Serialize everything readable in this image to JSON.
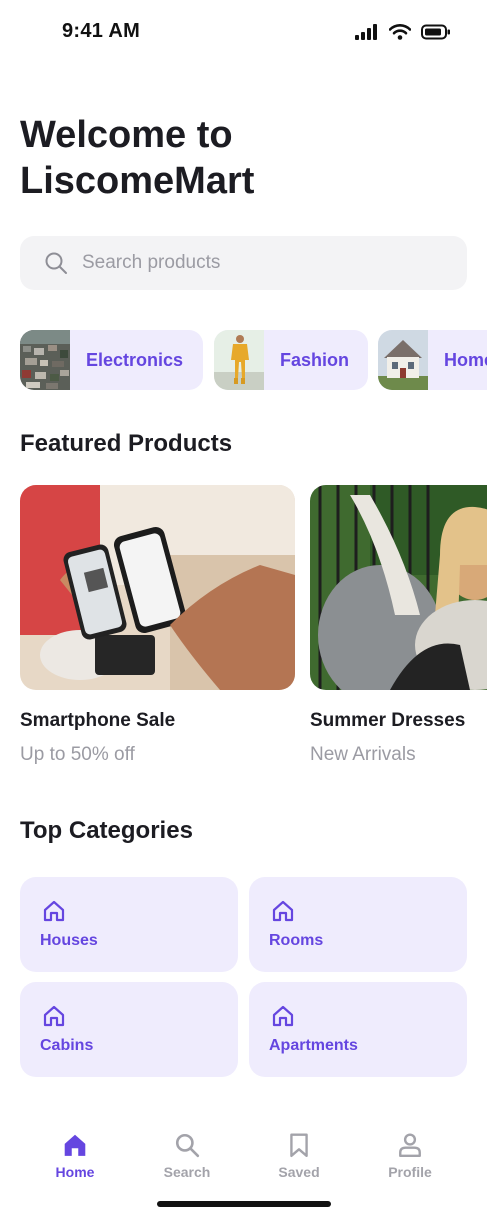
{
  "status_bar": {
    "time": "9:41 AM",
    "icons": [
      "signal-icon",
      "wifi-icon",
      "battery-icon"
    ]
  },
  "header": {
    "title_line1": "Welcome to",
    "title_line2": "LiscomeMart"
  },
  "search": {
    "placeholder": "Search products",
    "value": "",
    "icon": "search-icon"
  },
  "chips": [
    {
      "label": "Electronics",
      "thumb": "aerial-city-photo"
    },
    {
      "label": "Fashion",
      "thumb": "fashion-model-photo"
    },
    {
      "label": "Home",
      "thumb": "house-photo"
    }
  ],
  "featured": {
    "title": "Featured Products",
    "items": [
      {
        "name": "Smartphone Sale",
        "subtitle": "Up to 50% off",
        "image": "phone-payment-photo"
      },
      {
        "name": "Summer Dresses",
        "subtitle": "New Arrivals",
        "image": "woman-hammock-photo"
      }
    ]
  },
  "top_categories": {
    "title": "Top Categories",
    "items": [
      {
        "label": "Houses",
        "icon": "house-icon"
      },
      {
        "label": "Rooms",
        "icon": "house-icon"
      },
      {
        "label": "Cabins",
        "icon": "house-icon"
      },
      {
        "label": "Apartments",
        "icon": "house-icon"
      }
    ]
  },
  "tabbar": {
    "tabs": [
      {
        "label": "Home",
        "icon": "home-icon",
        "active": true
      },
      {
        "label": "Search",
        "icon": "search-icon",
        "active": false
      },
      {
        "label": "Saved",
        "icon": "bookmark-icon",
        "active": false
      },
      {
        "label": "Profile",
        "icon": "profile-icon",
        "active": false
      }
    ]
  },
  "colors": {
    "accent": "#6546E0",
    "chip_bg": "#EFECFD",
    "muted_text": "#9B9BA3",
    "search_bg": "#F3F3F5"
  }
}
